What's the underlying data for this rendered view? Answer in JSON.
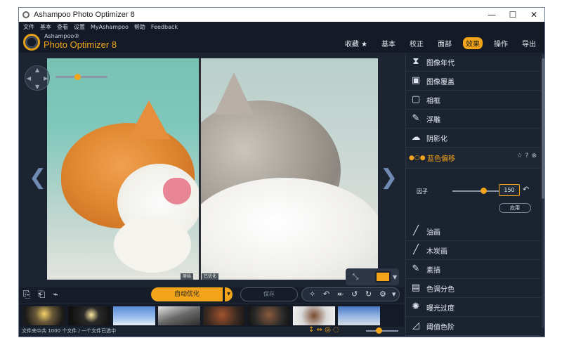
{
  "window": {
    "title": "Ashampoo Photo Optimizer 8",
    "min": "—",
    "max": "☐",
    "close": "✕"
  },
  "menu": [
    "文件",
    "基本",
    "查看",
    "设置",
    "MyAshampoo",
    "帮助",
    "Feedback"
  ],
  "brand": {
    "small": "Ashampoo®",
    "name": "Photo Optimizer 8"
  },
  "tabs": [
    {
      "label": "收藏 ★",
      "active": false
    },
    {
      "label": "基本",
      "active": false
    },
    {
      "label": "校正",
      "active": false
    },
    {
      "label": "面部",
      "active": false
    },
    {
      "label": "效果",
      "active": true
    },
    {
      "label": "操作",
      "active": false
    },
    {
      "label": "导出",
      "active": false
    }
  ],
  "viewer": {
    "before_label": "原始",
    "after_label": "已优化",
    "zoom_level_fraction": 0.4
  },
  "effects": [
    {
      "label": "图像年代",
      "icon": "hourglass-icon",
      "glyph": "⧗"
    },
    {
      "label": "图像覆盖",
      "icon": "image-overlay-icon",
      "glyph": "▣"
    },
    {
      "label": "相框",
      "icon": "frame-icon",
      "glyph": "▢"
    },
    {
      "label": "浮雕",
      "icon": "emboss-icon",
      "glyph": "✎"
    },
    {
      "label": "阴影化",
      "icon": "shadow-icon",
      "glyph": "☁"
    },
    {
      "label": "蓝色偏移",
      "icon": "blue-shift-icon",
      "glyph": "●○●",
      "active": true
    },
    {
      "label": "油画",
      "icon": "brush-icon",
      "glyph": "╱"
    },
    {
      "label": "木炭画",
      "icon": "charcoal-icon",
      "glyph": "╱"
    },
    {
      "label": "素描",
      "icon": "pencil-icon",
      "glyph": "✎"
    },
    {
      "label": "色调分色",
      "icon": "posterize-icon",
      "glyph": "▤"
    },
    {
      "label": "曝光过度",
      "icon": "overexpose-icon",
      "glyph": "✺"
    },
    {
      "label": "阈值色阶",
      "icon": "threshold-icon",
      "glyph": "◿"
    }
  ],
  "active_effect": {
    "factor_label": "因子",
    "factor_value": "150",
    "apply_label": "应用",
    "favorite": "☆",
    "help": "?",
    "close": "⊗"
  },
  "toolbar": {
    "auto_optimize": "自动优化",
    "save": "保存"
  },
  "status": {
    "text": "文件夹中共 1000 个文件 / 一个文件已选中"
  },
  "colors": {
    "accent": "#f2a51a",
    "bg": "#1d2431",
    "panel": "#1b2230"
  }
}
